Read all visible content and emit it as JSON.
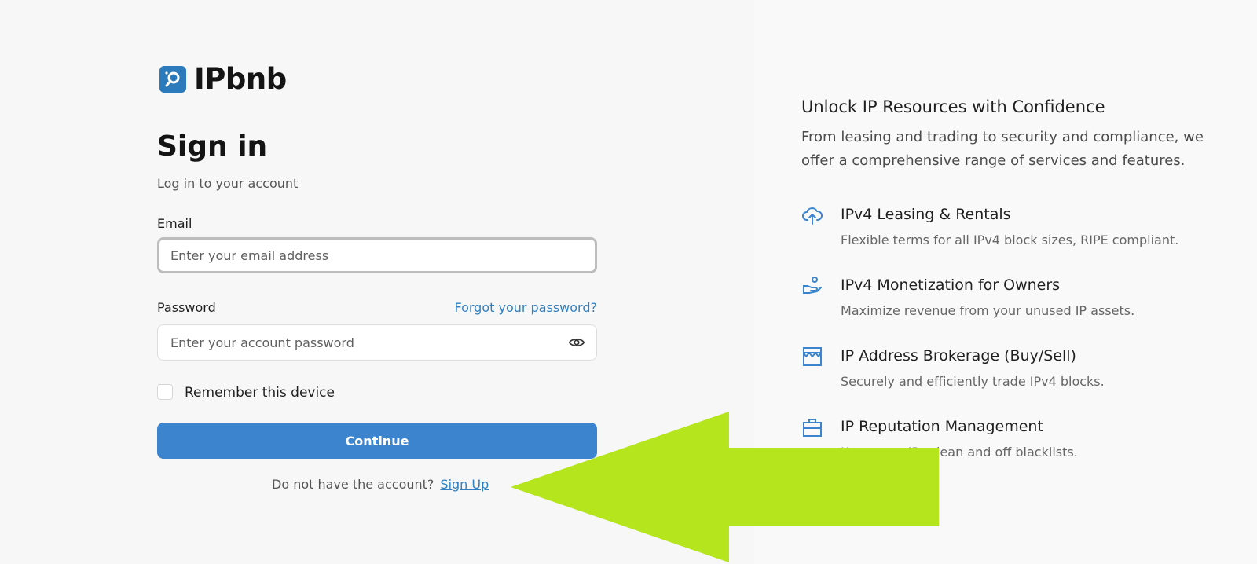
{
  "brand": {
    "name": "IPbnb",
    "color": "#2b7abb"
  },
  "signin": {
    "title": "Sign in",
    "subtitle": "Log in to your account",
    "email_label": "Email",
    "email_placeholder": "Enter your email address",
    "email_value": "",
    "password_label": "Password",
    "forgot_label": "Forgot your password?",
    "password_placeholder": "Enter your account password",
    "password_value": "",
    "remember_label": "Remember this device",
    "remember_checked": false,
    "continue_label": "Continue",
    "signup_prompt": "Do not have the account?",
    "signup_label": "Sign Up"
  },
  "promo": {
    "title": "Unlock IP Resources with Confidence",
    "description": "From leasing and trading to security and compliance, we offer a comprehensive range of services and features.",
    "features": [
      {
        "icon": "cloud-upload-icon",
        "title": "IPv4 Leasing & Rentals",
        "description": "Flexible terms for all IPv4 block sizes, RIPE compliant."
      },
      {
        "icon": "hand-coins-icon",
        "title": "IPv4 Monetization for Owners",
        "description": "Maximize revenue from your unused IP assets."
      },
      {
        "icon": "storefront-icon",
        "title": "IP Address Brokerage (Buy/Sell)",
        "description": "Securely and efficiently trade IPv4 blocks."
      },
      {
        "icon": "briefcase-icon",
        "title": "IP Reputation Management",
        "description": "Keep your IPs clean and off blacklists."
      }
    ]
  },
  "colors": {
    "accent": "#3d84cf",
    "link": "#2f7fc1",
    "overlay_arrow": "#b5e61d"
  }
}
